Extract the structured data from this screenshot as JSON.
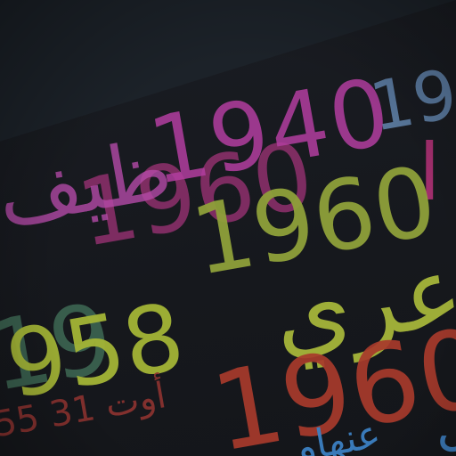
{
  "scene": {
    "text_fragments": {
      "t1940": "1940",
      "t19_top": "19",
      "red_letter": "ا",
      "arabic_1": "ظيف",
      "t1960_pink": "1960",
      "t1960_green": "1960",
      "t19_dark": "19",
      "t1958": "958",
      "arabic_2": "عري",
      "t1960_red": "1960",
      "date_fragment": "55 أوت 31",
      "blue_fragment": "عنهاو",
      "blue_edge": "ل"
    },
    "colors": {
      "wall": "#1c2229",
      "board": "#16181d",
      "magenta": "#b33ea0",
      "green": "#a4b536",
      "red": "#a83a2c",
      "blue": "#3c80c2"
    }
  }
}
